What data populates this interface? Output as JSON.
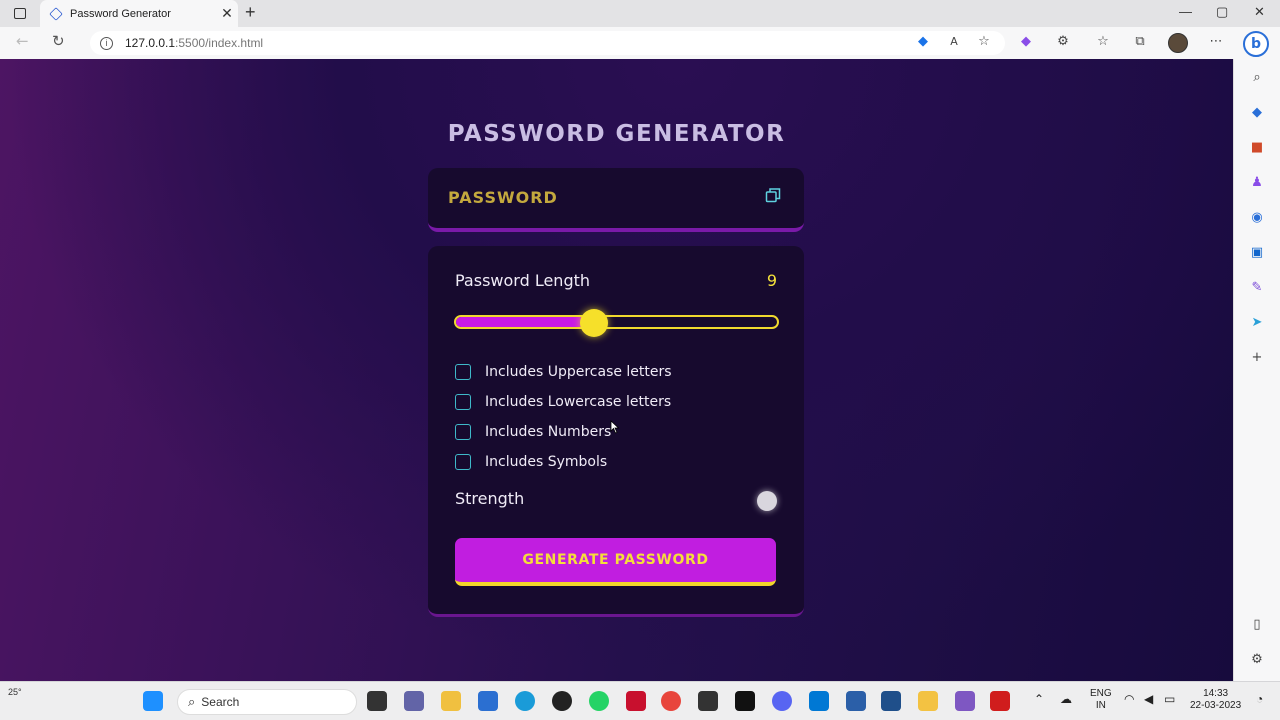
{
  "browser": {
    "tab_title": "Password Generator",
    "tab_close": "✕",
    "new_tab": "+",
    "url_host": "127.0.0.1",
    "url_path": ":5500/index.html",
    "window_controls": [
      "—",
      "▢",
      "✕"
    ]
  },
  "page": {
    "title": "PASSWORD GENERATOR",
    "password_display": {
      "placeholder": "PASSWORD",
      "copy_icon": "copy-icon"
    },
    "length": {
      "label": "Password Length",
      "value": "9",
      "slider_fraction": 0.43
    },
    "options": [
      {
        "label": "Includes Uppercase letters",
        "checked": false
      },
      {
        "label": "Includes Lowercase letters",
        "checked": false
      },
      {
        "label": "Includes Numbers",
        "checked": false
      },
      {
        "label": "Includes Symbols",
        "checked": false
      }
    ],
    "strength": {
      "label": "Strength",
      "indicator_color": "#d9d6de"
    },
    "generate_button": "GENERATE PASSWORD",
    "colors": {
      "accent_yellow": "#f6e02a",
      "accent_magenta": "#c11ee0",
      "card_bg": "#170a2e",
      "checkbox_border": "#3fb9c9"
    }
  },
  "taskbar": {
    "weather": "25°",
    "search_label": "Search",
    "language": "ENG",
    "region": "IN",
    "time": "14:33",
    "date": "22-03-2023"
  }
}
